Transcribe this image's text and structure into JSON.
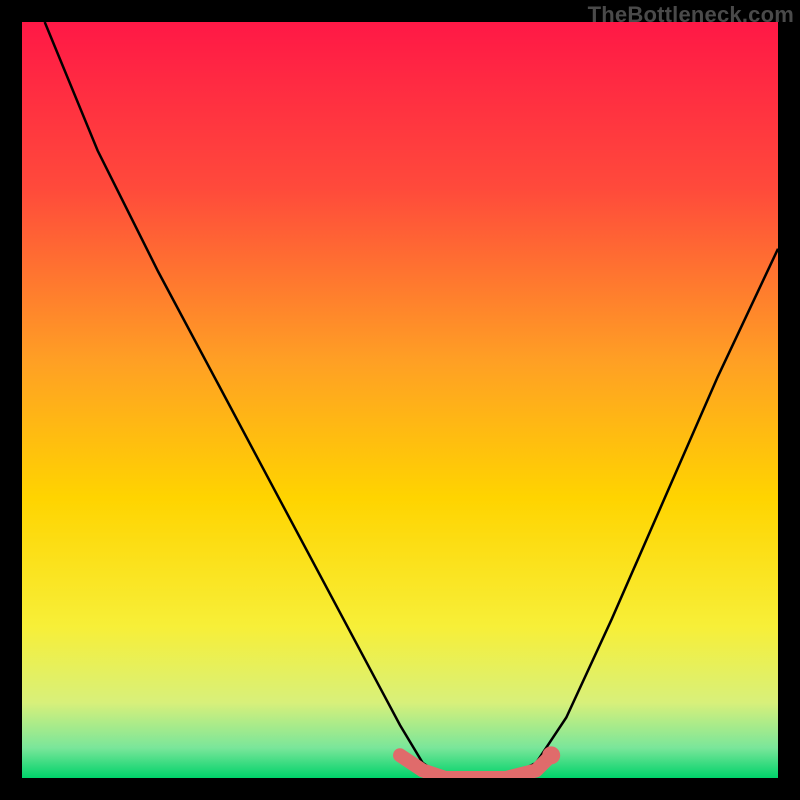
{
  "watermark": "TheBottleneck.com",
  "chart_data": {
    "type": "line",
    "title": "",
    "xlabel": "",
    "ylabel": "",
    "xlim": [
      0,
      100
    ],
    "ylim": [
      0,
      100
    ],
    "grid": false,
    "legend": false,
    "background_gradient_vertical": {
      "stops": [
        {
          "pos": 0.0,
          "color": "#ff1846"
        },
        {
          "pos": 0.22,
          "color": "#ff4a3b"
        },
        {
          "pos": 0.45,
          "color": "#ffa024"
        },
        {
          "pos": 0.63,
          "color": "#ffd400"
        },
        {
          "pos": 0.8,
          "color": "#f7ef38"
        },
        {
          "pos": 0.9,
          "color": "#d8f07a"
        },
        {
          "pos": 0.96,
          "color": "#7ae69a"
        },
        {
          "pos": 1.0,
          "color": "#00d26a"
        }
      ]
    },
    "series": [
      {
        "name": "bottleneck-curve",
        "type": "line",
        "color": "#000000",
        "x": [
          3,
          10,
          18,
          26,
          34,
          42,
          50,
          53,
          56,
          60,
          64,
          68,
          72,
          78,
          85,
          92,
          100
        ],
        "y": [
          100,
          83,
          67,
          52,
          37,
          22,
          7,
          2,
          0,
          0,
          0,
          2,
          8,
          21,
          37,
          53,
          70
        ]
      },
      {
        "name": "optimal-band",
        "type": "line",
        "color": "#e06b6b",
        "stroke_width": 14,
        "x": [
          50,
          53,
          56,
          60,
          64,
          68,
          70
        ],
        "y": [
          3,
          1,
          0,
          0,
          0,
          1,
          3
        ]
      }
    ],
    "annotations": [
      {
        "name": "optimal-end-dot",
        "type": "dot",
        "color": "#e06b6b",
        "radius": 9,
        "x": 70,
        "y": 3
      }
    ]
  }
}
